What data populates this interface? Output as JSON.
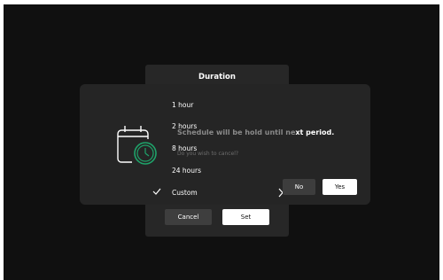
{
  "picker": {
    "title": "Duration",
    "options": [
      "1 hour",
      "2 hours",
      "8 hours",
      "24 hours",
      "Custom"
    ],
    "selected": "Custom",
    "cancel_label": "Cancel",
    "set_label": "Set"
  },
  "confirm": {
    "message_a": "Schedule will be hold until ne",
    "message_b": "xt period.",
    "question": "Do you wish to cancel?",
    "no_label": "No",
    "yes_label": "Yes"
  },
  "icons": {
    "calendar": "calendar-clock-icon",
    "check": "check-icon",
    "chevron": "chevron-right-icon"
  },
  "colors": {
    "accent_green": "#1fa36a",
    "background": "#101010",
    "dialog": "#252525"
  }
}
